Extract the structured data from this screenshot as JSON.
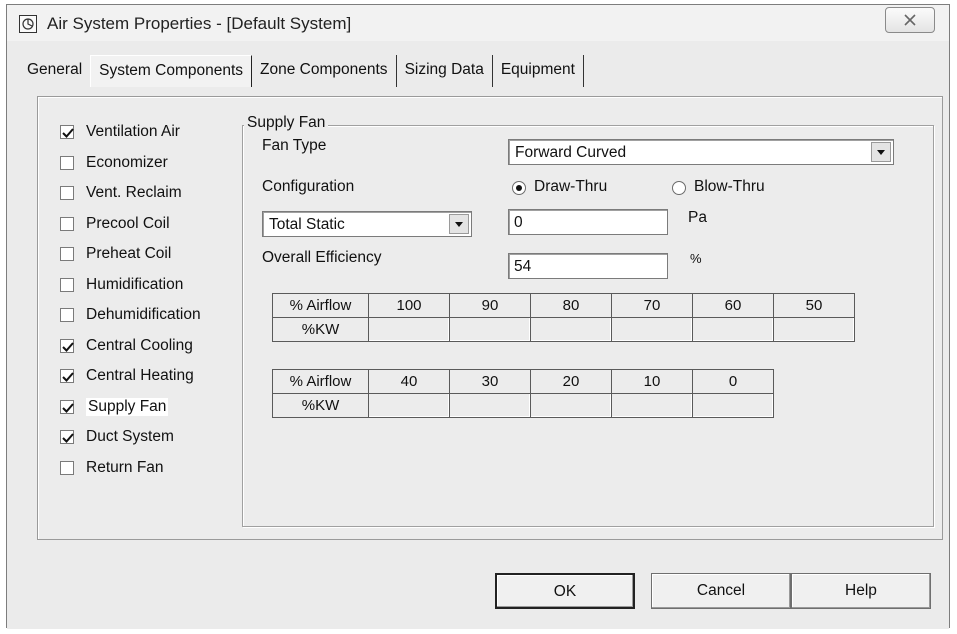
{
  "window": {
    "title": "Air System Properties - [Default System]",
    "close_glyph": "☒"
  },
  "tabs": [
    {
      "label": "General"
    },
    {
      "label": "System Components",
      "active": true
    },
    {
      "label": "Zone Components"
    },
    {
      "label": "Sizing Data"
    },
    {
      "label": "Equipment"
    }
  ],
  "components": [
    {
      "label": "Ventilation Air",
      "checked": true
    },
    {
      "label": "Economizer",
      "checked": false
    },
    {
      "label": "Vent. Reclaim",
      "checked": false
    },
    {
      "label": "Precool Coil",
      "checked": false
    },
    {
      "label": "Preheat Coil",
      "checked": false
    },
    {
      "label": "Humidification",
      "checked": false
    },
    {
      "label": "Dehumidification",
      "checked": false
    },
    {
      "label": "Central Cooling",
      "checked": true
    },
    {
      "label": "Central Heating",
      "checked": true
    },
    {
      "label": "Supply Fan",
      "checked": true,
      "selected": true
    },
    {
      "label": "Duct System",
      "checked": true
    },
    {
      "label": "Return Fan",
      "checked": false
    }
  ],
  "supply_fan": {
    "group_label": "Supply Fan",
    "fan_type_label": "Fan Type",
    "fan_type_value": "Forward Curved",
    "configuration_label": "Configuration",
    "draw_thru_label": "Draw-Thru",
    "blow_thru_label": "Blow-Thru",
    "configuration_selected": "Draw-Thru",
    "static_type_value": "Total Static",
    "static_value": "0",
    "static_unit": "Pa",
    "efficiency_label": "Overall Efficiency",
    "efficiency_value": "54",
    "efficiency_unit": "%"
  },
  "airflow_table_1": {
    "row1_label": "% Airflow",
    "row2_label": "%KW",
    "airflow": [
      "100",
      "90",
      "80",
      "70",
      "60",
      "50"
    ]
  },
  "airflow_table_2": {
    "row1_label": "% Airflow",
    "row2_label": "%KW",
    "airflow": [
      "40",
      "30",
      "20",
      "10",
      "0"
    ]
  },
  "buttons": {
    "ok": "OK",
    "cancel": "Cancel",
    "help": "Help"
  },
  "icons": {
    "app": "fan-window-icon",
    "dropdown": "dropdown-arrow-icon",
    "check": "checkmark-icon"
  }
}
